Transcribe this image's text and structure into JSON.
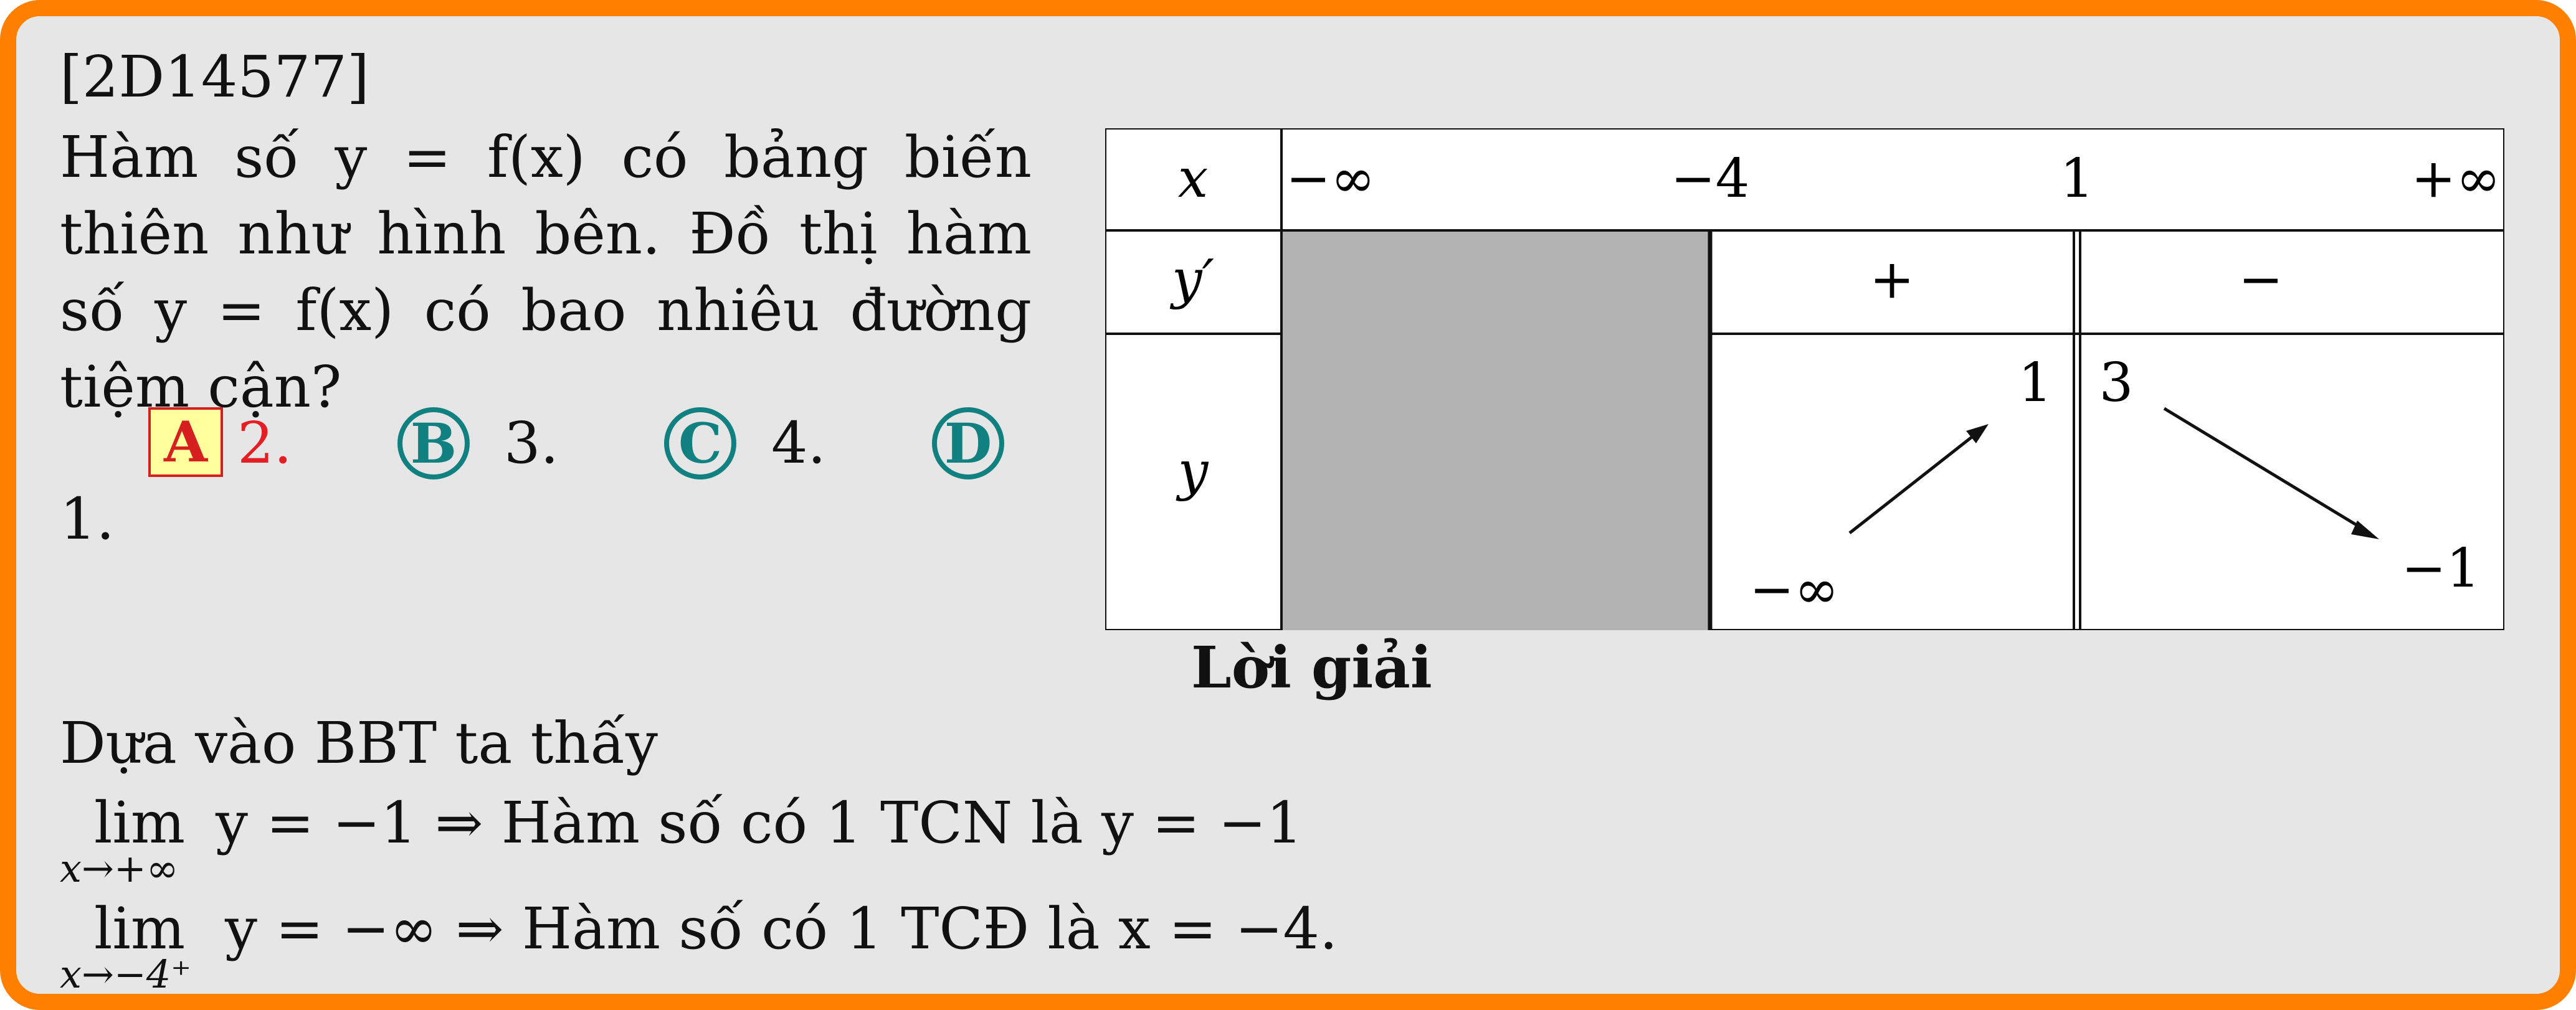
{
  "question": {
    "id": "[2D14577]",
    "text": "Hàm số y = f(x) có bảng biến thiên như hình bên. Đồ thị hàm số y = f(x) có bao nhiêu đường tiệm cận?",
    "choices": [
      {
        "letter": "A",
        "value": "2.",
        "correct": true
      },
      {
        "letter": "B",
        "value": "3.",
        "correct": false
      },
      {
        "letter": "C",
        "value": "4.",
        "correct": false
      },
      {
        "letter": "D",
        "value": "1.",
        "correct": false
      }
    ]
  },
  "variation_table": {
    "row_labels": [
      "x",
      "y′",
      "y"
    ],
    "x_values": [
      "−∞",
      "−4",
      "1",
      "+∞"
    ],
    "derivative_signs": [
      "+",
      "−"
    ],
    "y_values": {
      "start_interval2": "−∞",
      "end_interval2": "1",
      "start_interval3": "3",
      "end_interval3": "−1"
    },
    "shaded_interval": "(−∞; −4)"
  },
  "solution": {
    "heading": "Lời giải",
    "intro": "Dựa vào BBT ta thấy",
    "line1_lim": "lim",
    "line1_sub": "x→+∞",
    "line1_rest": "y = −1 ⇒ Hàm số có 1 TCN là y = −1",
    "line2_lim": "lim",
    "line2_sub": "x→−4⁺",
    "line2_rest": "y = −∞ ⇒ Hàm số có 1 TCĐ là x = −4."
  },
  "colors": {
    "frame": "#ff8000",
    "background": "#e6e6e6",
    "correct": "#e31e24",
    "choice_circle": "#118080",
    "shade": "#b3b3b3"
  }
}
